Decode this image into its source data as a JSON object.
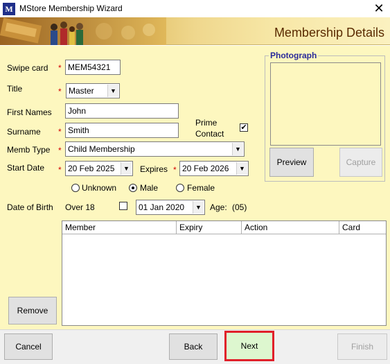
{
  "window": {
    "title": "MStore Membership Wizard",
    "app_icon": "M",
    "close_icon": "close-icon"
  },
  "banner": {
    "heading": "Membership Details"
  },
  "form": {
    "swipe_card": {
      "label": "Swipe card",
      "value": "MEM54321",
      "required": true
    },
    "title": {
      "label": "Title",
      "value": "Master",
      "required": true
    },
    "first_names": {
      "label": "First Names",
      "value": "John"
    },
    "surname": {
      "label": "Surname",
      "value": "Smith",
      "required": true
    },
    "prime_contact": {
      "label_line1": "Prime",
      "label_line2": "Contact",
      "checked": true,
      "check_mark": "✔"
    },
    "memb_type": {
      "label": "Memb Type",
      "value": "Child Membership",
      "required": true
    },
    "start_date": {
      "label": "Start Date",
      "value": "20 Feb 2025",
      "required": true
    },
    "expires": {
      "label": "Expires",
      "value": "20 Feb 2026",
      "required": true
    },
    "gender": {
      "options": [
        "Unknown",
        "Male",
        "Female"
      ],
      "selected": "Male"
    },
    "date_of_birth": {
      "label": "Date of Birth",
      "over18_label": "Over 18",
      "over18_checked": false,
      "value": "01 Jan 2020",
      "age_label": "Age:",
      "age_value": "(05)"
    }
  },
  "photograph": {
    "legend": "Photograph",
    "preview_label": "Preview",
    "capture_label": "Capture"
  },
  "members_table": {
    "columns": [
      "Member",
      "Expiry",
      "Action",
      "Card"
    ],
    "rows": []
  },
  "remove_label": "Remove",
  "footer": {
    "cancel_label": "Cancel",
    "back_label": "Back",
    "next_label": "Next",
    "finish_label": "Finish"
  },
  "colors": {
    "panel_bg": "#fdf7bf",
    "required": "#d40000",
    "highlight_border": "#e0202a",
    "next_bg": "#ddf7cf"
  }
}
